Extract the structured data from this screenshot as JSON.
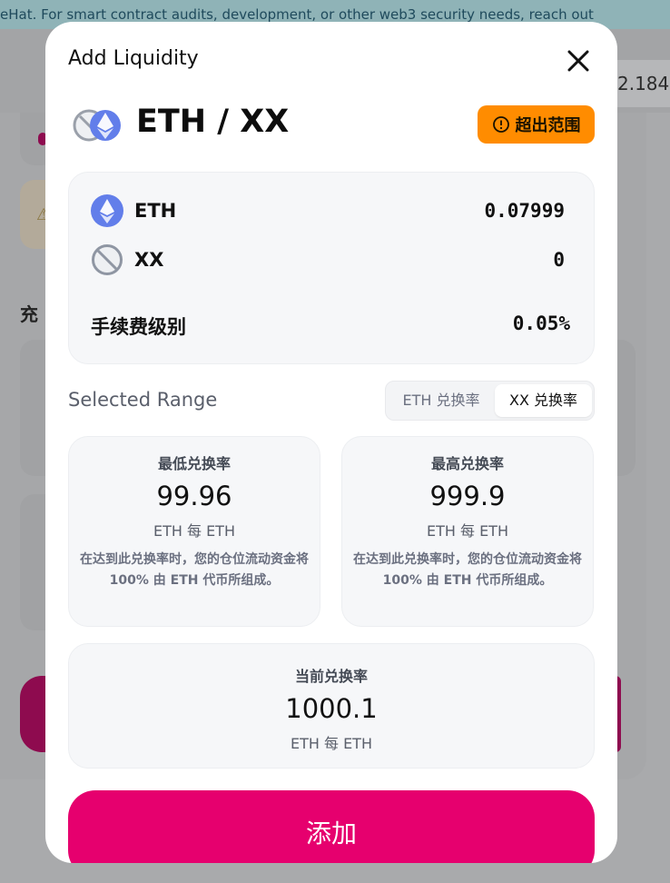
{
  "background": {
    "banner_text": "eHat. For smart contract audits, development, or other web3 security needs, reach out",
    "balance_partial": "2.184",
    "section_label_partial": "充"
  },
  "modal": {
    "title": "Add Liquidity",
    "pair_title": "ETH / XX",
    "status_badge": "超出范围",
    "tokens": [
      {
        "symbol": "ETH",
        "amount": "0.07999",
        "icon": "eth-icon"
      },
      {
        "symbol": "XX",
        "amount": "0",
        "icon": "unknown-token-icon"
      }
    ],
    "fee_tier_label": "手续费级别",
    "fee_tier_value": "0.05%",
    "selected_range_label": "Selected Range",
    "rate_toggle": {
      "option_1": "ETH 兑换率",
      "option_2": "XX 兑换率",
      "selected": "XX 兑换率"
    },
    "min_price": {
      "label": "最低兑换率",
      "value": "99.96",
      "unit": "ETH 每 ETH",
      "note": "在达到此兑换率时，您的仓位流动资金将 100% 由 ETH 代币所组成。"
    },
    "max_price": {
      "label": "最高兑换率",
      "value": "999.9",
      "unit": "ETH 每 ETH",
      "note": "在达到此兑换率时，您的仓位流动资金将 100% 由 ETH 代币所组成。"
    },
    "current_price": {
      "label": "当前兑换率",
      "value": "1000.1",
      "unit": "ETH 每 ETH"
    },
    "add_button": "添加"
  },
  "colors": {
    "accent": "#e6006e",
    "badge": "#ff8c00",
    "eth": "#627eea"
  }
}
